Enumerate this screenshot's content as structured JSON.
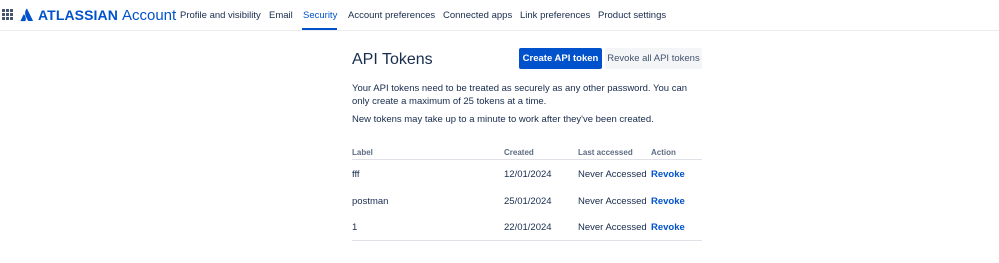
{
  "header": {
    "brand": "ATLASSIAN",
    "product": "Account",
    "nav": [
      {
        "label": "Profile and visibility"
      },
      {
        "label": "Email"
      },
      {
        "label": "Security"
      },
      {
        "label": "Account preferences"
      },
      {
        "label": "Connected apps"
      },
      {
        "label": "Link preferences"
      },
      {
        "label": "Product settings"
      }
    ],
    "active_nav": "Security",
    "accent_color": "#0052cc"
  },
  "main": {
    "title": "API Tokens",
    "create_button": "Create API token",
    "revoke_all_button": "Revoke all API tokens",
    "description_1": "Your API tokens need to be treated as securely as any other password. You can only create a maximum of 25 tokens at a time.",
    "description_2": "New tokens may take up to a minute to work after they've been created.",
    "table": {
      "columns": [
        "Label",
        "Created",
        "Last accessed",
        "Action"
      ],
      "rows": [
        {
          "label": "fff",
          "created": "12/01/2024",
          "last_accessed": "Never Accessed",
          "action": "Revoke"
        },
        {
          "label": "postman",
          "created": "25/01/2024",
          "last_accessed": "Never Accessed",
          "action": "Revoke"
        },
        {
          "label": "1",
          "created": "22/01/2024",
          "last_accessed": "Never Accessed",
          "action": "Revoke"
        }
      ]
    }
  },
  "icons": {
    "app_switcher": "grid-icon",
    "logo": "atlassian-logo-icon"
  }
}
